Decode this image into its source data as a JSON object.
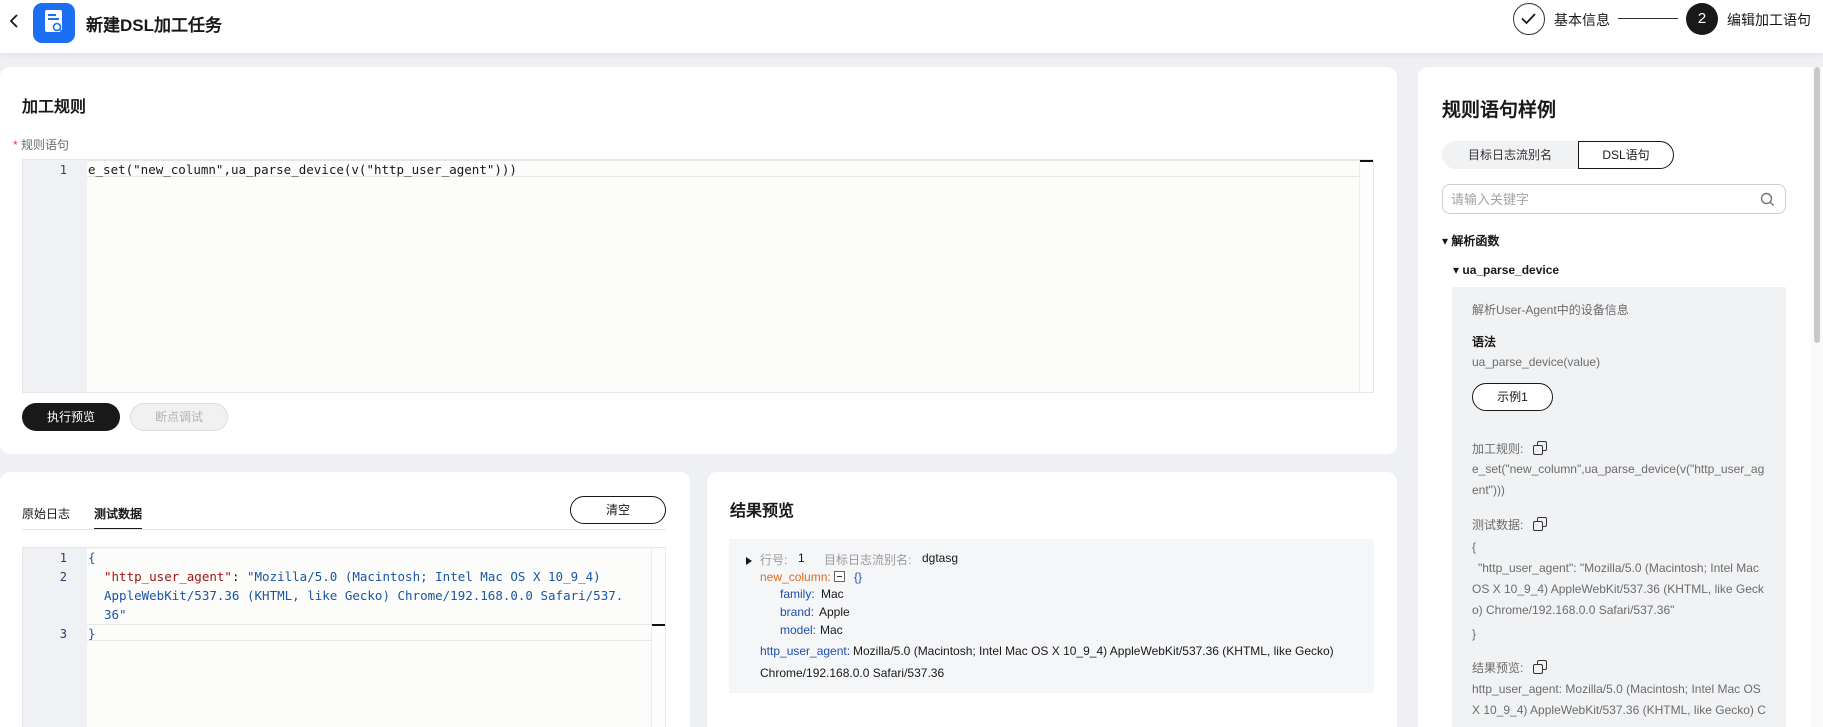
{
  "header": {
    "title": "新建DSL加工任务",
    "steps": [
      {
        "label": "基本信息",
        "state": "done"
      },
      {
        "number": "2",
        "label": "编辑加工语句",
        "state": "active"
      }
    ]
  },
  "rule": {
    "section_title": "加工规则",
    "field_label": "规则语句",
    "required_mark": "*",
    "line_number": "1",
    "code": "e_set(\"new_column\",ua_parse_device(v(\"http_user_agent\")))",
    "run_preview_button": "执行预览",
    "debug_button": "断点调试"
  },
  "test_data": {
    "tabs": [
      "原始日志",
      "测试数据"
    ],
    "active_tab": "测试数据",
    "clear_button": "清空",
    "line_numbers": [
      "1",
      "2",
      "3"
    ],
    "open_brace": "{",
    "key": "\"http_user_agent\"",
    "colon": ": ",
    "value_line1": "\"Mozilla/5.0 (Macintosh; Intel Mac OS X 10_9_4)",
    "value_line2": "AppleWebKit/537.36 (KHTML, like Gecko) Chrome/192.168.0.0 Safari/537.",
    "value_line3": "36\"",
    "close_brace": "}"
  },
  "result": {
    "title": "结果预览",
    "row_label": "行号:",
    "row_value": "1",
    "stream_label": "目标日志流别名:",
    "stream_value": "dgtasg",
    "new_column_key": "new_column:",
    "new_column_brace": "{}",
    "fields": [
      {
        "key": "family:",
        "value": "Mac"
      },
      {
        "key": "brand:",
        "value": "Apple"
      },
      {
        "key": "model:",
        "value": "Mac"
      }
    ],
    "ua_key": "http_user_agent:",
    "ua_value_line1": "Mozilla/5.0 (Macintosh; Intel Mac OS X 10_9_4) AppleWebKit/537.36 (KHTML, like Gecko)",
    "ua_value_line2": "Chrome/192.168.0.0 Safari/537.36"
  },
  "samples": {
    "title": "规则语句样例",
    "segments": [
      "目标日志流别名",
      "DSL语句"
    ],
    "active_segment": "DSL语句",
    "search_placeholder": "请输入关键字",
    "category": "▾ 解析函数",
    "function_node": "▾ ua_parse_device",
    "description": "解析User-Agent中的设备信息",
    "syntax_label": "语法",
    "syntax": "ua_parse_device(value)",
    "example_button": "示例1",
    "rule_label": "加工规则:",
    "rule_code": "e_set(\"new_column\",ua_parse_device(v(\"http_user_agent\")))",
    "test_label": "测试数据:",
    "test_open": "{",
    "test_body": "\"http_user_agent\": \"Mozilla/5.0 (Macintosh; Intel Mac OS X 10_9_4) AppleWebKit/537.36 (KHTML, like Gecko) Chrome/192.168.0.0 Safari/537.36\"",
    "test_close": "}",
    "result_label": "结果预览:",
    "result_text": "http_user_agent: Mozilla/5.0 (Macintosh; Intel Mac OS X 10_9_4) AppleWebKit/537.36 (KHTML, like Gecko) C"
  },
  "colors": {
    "accent": "#191919",
    "brand_logo": "#1c6ef2",
    "json_key": "#a31515",
    "json_string": "#1a55a6",
    "result_key_orange": "#e06b1f",
    "result_key_blue": "#1e4db0"
  }
}
